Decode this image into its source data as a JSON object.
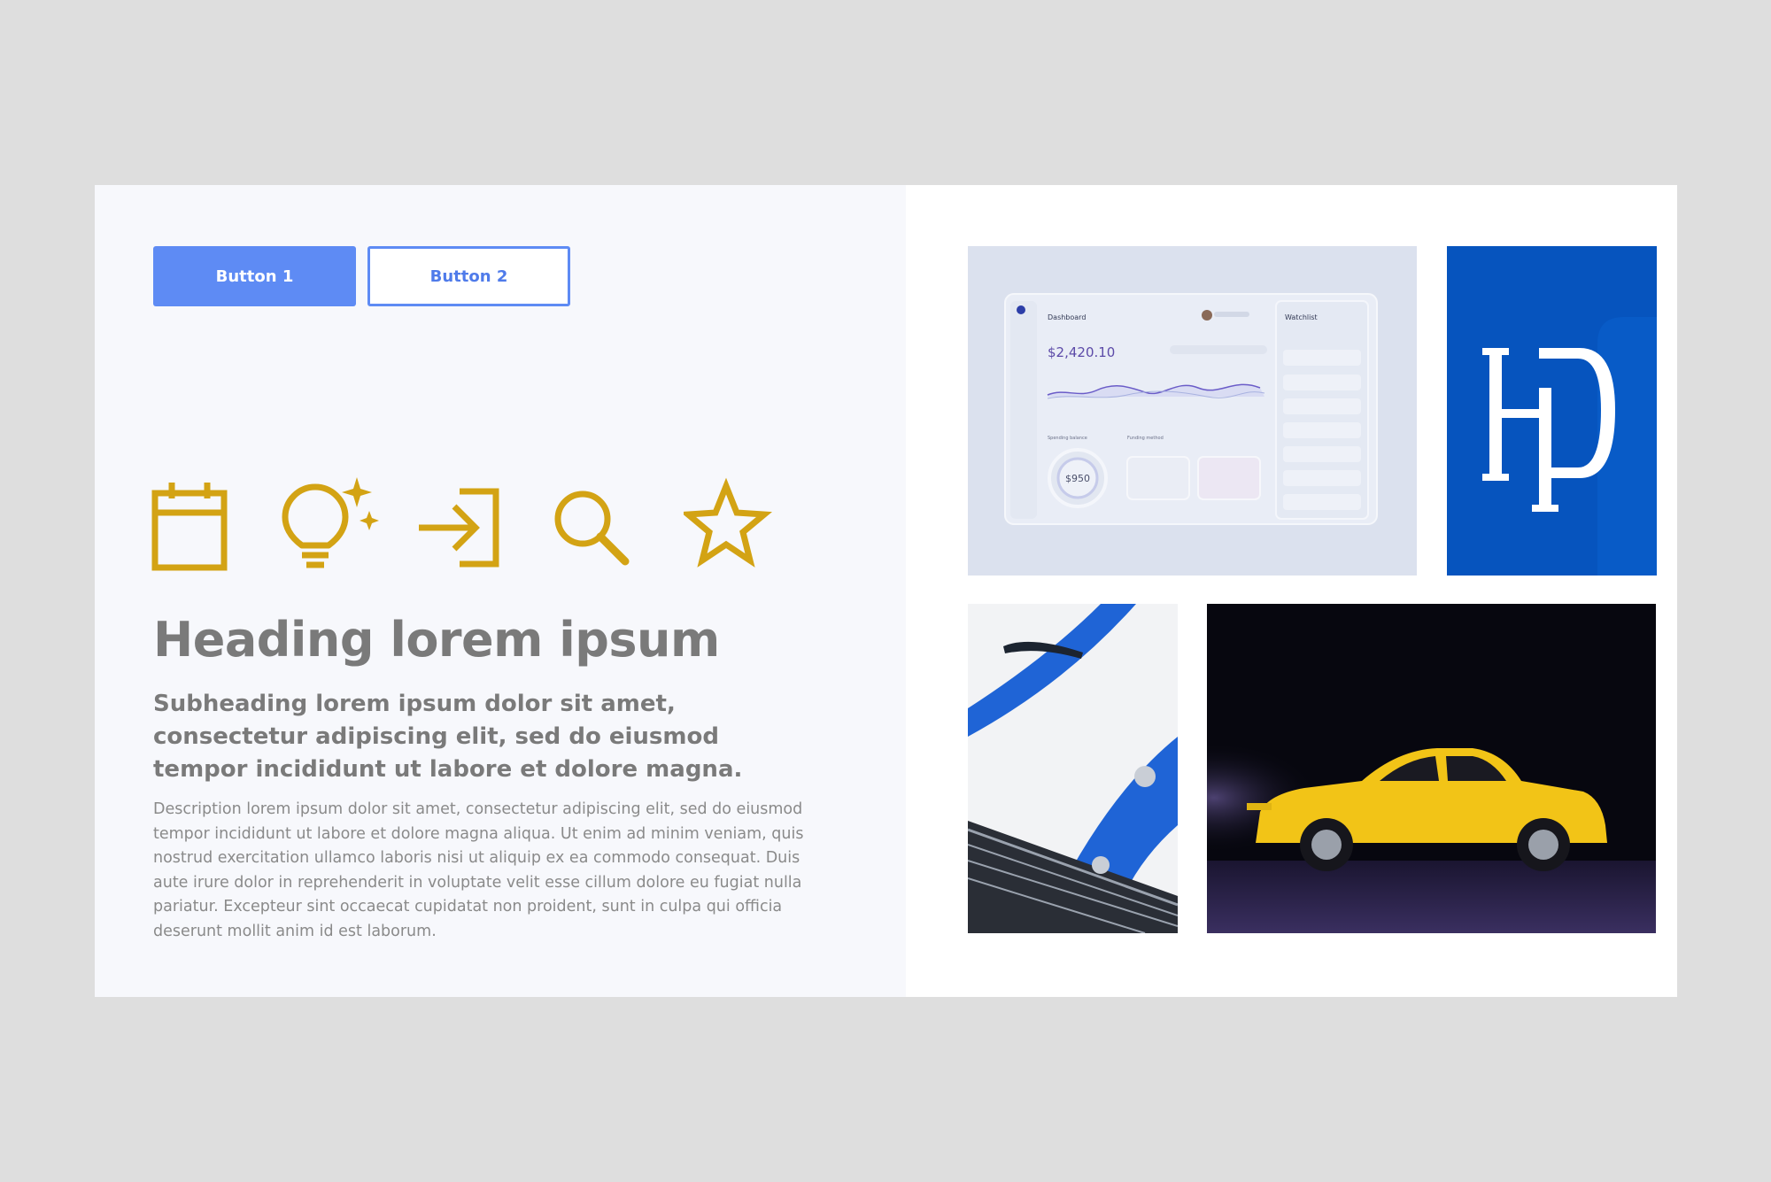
{
  "buttons": {
    "button1_label": "Button 1",
    "button2_label": "Button 2"
  },
  "icons": [
    "calendar-icon",
    "lightbulb-sparkle-icon",
    "login-arrow-icon",
    "search-icon",
    "star-icon"
  ],
  "content": {
    "heading": "Heading lorem ipsum",
    "subheading": "Subheading lorem ipsum dolor sit amet, consectetur adipiscing elit, sed do eiusmod tempor incididunt ut labore et dolore magna.",
    "description": "Description lorem ipsum dolor sit amet, consectetur adipiscing elit, sed do eiusmod tempor incididunt ut labore et dolore magna aliqua. Ut enim ad minim veniam, quis nostrud exercitation ullamco laboris nisi ut aliquip ex ea commodo consequat. Duis aute irure dolor in reprehenderit in voluptate velit esse cillum dolore eu fugiat nulla pariatur. Excepteur sint occaecat cupidatat non proident, sunt in culpa qui officia deserunt mollit anim id est laborum."
  },
  "dashboard_image": {
    "title": "Dashboard",
    "balance": "$2,420.10",
    "watchlist_title": "Watchlist",
    "spending_value": "$950",
    "spending_label": "Spending balance",
    "payment_label": "Funding method"
  },
  "logo_image": {
    "monogram": "HD"
  },
  "colors": {
    "background": "#dedede",
    "panel": "#f7f8fc",
    "primary_button": "#5e8bf4",
    "icon_gold": "#d3a314",
    "text_gray": "#7a7a7a",
    "logo_blue": "#0654be"
  }
}
